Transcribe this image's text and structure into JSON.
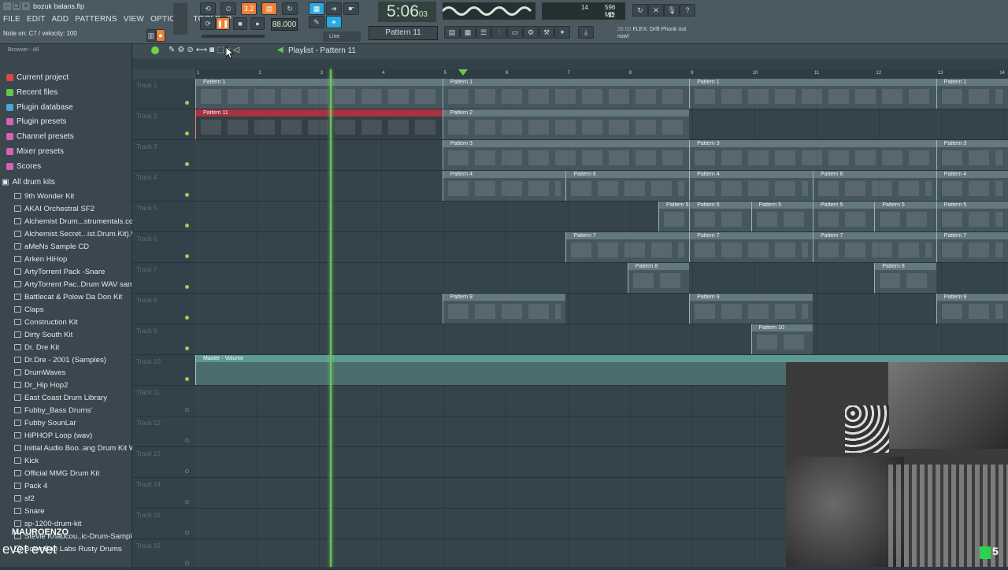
{
  "window": {
    "title": "bozuk balans.flp"
  },
  "menu": [
    "FILE",
    "EDIT",
    "ADD",
    "PATTERNS",
    "VIEW",
    "OPTIONS",
    "TOOLS",
    "?"
  ],
  "hint_bar": "Note on: C7 / velocity: 100",
  "transport": {
    "time": "5:06",
    "time_small": "03",
    "tempo": "88.000",
    "snap": "Line",
    "pattern": "Pattern 11"
  },
  "cpu": {
    "value1": "14",
    "value2": "596 MB",
    "value3": "12"
  },
  "news": {
    "date": "26.02",
    "text": "FLEX: Drift Phonk out now!"
  },
  "browser": {
    "header": "Browser - All",
    "categories": [
      {
        "label": "Current project",
        "color": "#e04646"
      },
      {
        "label": "Recent files",
        "color": "#6cc14a"
      },
      {
        "label": "Plugin database",
        "color": "#4ba3d8"
      },
      {
        "label": "Plugin presets",
        "color": "#d860b8"
      },
      {
        "label": "Channel presets",
        "color": "#d860b8"
      },
      {
        "label": "Mixer presets",
        "color": "#d860b8"
      },
      {
        "label": "Scores",
        "color": "#d860b8"
      }
    ],
    "folder_open": "All drum kits",
    "folders": [
      "9th Wonder Kit",
      "AKAI Orchestral SF2",
      "Alchemist Drum...strumentals.com)",
      "Alchemist.Secret...ist.Drum.Kit).WAV",
      "aMeNs Sample CD",
      "Arken HiHop",
      "ArtyTorrent Pack -Snare",
      "ArtyTorrent Pac..Drum WAV samples",
      "Battlecat & Polow Da Don Kit",
      "Claps",
      "Construction Kit",
      "Dirty South Kit",
      "Dr. Dre Kit",
      "Dr.Dre - 2001 (Samples)",
      "DrumWaves",
      "Dr_Hip Hop2",
      "East Coast Drum Library",
      "Fubby_Bass Drums'",
      "Fubby SounLar",
      "HiPHOP Loop (wav)",
      "Initial Audio Boo..ang Drum Kit WiN",
      "Kick",
      "Official MMG Drum Kit",
      "Pack 4",
      "sf2",
      "Snare",
      "sp-1200-drum-kit",
      "Stevie Knaucou..ic-Drum-Samples",
      "BoomBap Labs Rusty Drums"
    ]
  },
  "playlist": {
    "title": "Playlist - Pattern 11",
    "ruler": [
      "1",
      "2",
      "3",
      "4",
      "5",
      "6",
      "7",
      "8",
      "9",
      "10",
      "11",
      "12",
      "13",
      "14"
    ],
    "tracks": [
      "Track 1",
      "Track 2",
      "Track 3",
      "Track 4",
      "Track 5",
      "Track 6",
      "Track 7",
      "Track 8",
      "Track 9",
      "Track 10",
      "Track 11",
      "Track 12",
      "Track 13",
      "Track 14",
      "Track 15",
      "Track 16"
    ],
    "clips": [
      {
        "track": 0,
        "bar": 1,
        "len": 4,
        "label": "Pattern 1"
      },
      {
        "track": 0,
        "bar": 5,
        "len": 4,
        "label": "Pattern 1"
      },
      {
        "track": 0,
        "bar": 9,
        "len": 4,
        "label": "Pattern 1"
      },
      {
        "track": 0,
        "bar": 13,
        "len": 1.2,
        "label": "Pattern 1"
      },
      {
        "track": 1,
        "bar": 1,
        "len": 4,
        "label": "Pattern 11",
        "kind": "red"
      },
      {
        "track": 1,
        "bar": 5,
        "len": 4,
        "label": "Pattern 2"
      },
      {
        "track": 2,
        "bar": 5,
        "len": 4,
        "label": "Pattern 3"
      },
      {
        "track": 2,
        "bar": 9,
        "len": 4,
        "label": "Pattern 3"
      },
      {
        "track": 2,
        "bar": 13,
        "len": 1.2,
        "label": "Pattern 3"
      },
      {
        "track": 3,
        "bar": 5,
        "len": 2,
        "label": "Pattern 4"
      },
      {
        "track": 3,
        "bar": 7,
        "len": 2,
        "label": "Pattern 6"
      },
      {
        "track": 3,
        "bar": 9,
        "len": 2,
        "label": "Pattern 4"
      },
      {
        "track": 3,
        "bar": 11,
        "len": 2,
        "label": "Pattern 6"
      },
      {
        "track": 3,
        "bar": 13,
        "len": 1.2,
        "label": "Pattern 4"
      },
      {
        "track": 4,
        "bar": 8.5,
        "len": 0.5,
        "label": "Pattern 5"
      },
      {
        "track": 4,
        "bar": 9,
        "len": 1,
        "label": "Pattern 5"
      },
      {
        "track": 4,
        "bar": 10,
        "len": 1,
        "label": "Pattern 5"
      },
      {
        "track": 4,
        "bar": 11,
        "len": 1,
        "label": "Pattern 5"
      },
      {
        "track": 4,
        "bar": 12,
        "len": 1,
        "label": "Pattern 5"
      },
      {
        "track": 4,
        "bar": 13,
        "len": 1.2,
        "label": "Pattern 5"
      },
      {
        "track": 5,
        "bar": 7,
        "len": 2,
        "label": "Pattern 7"
      },
      {
        "track": 5,
        "bar": 9,
        "len": 2,
        "label": "Pattern 7"
      },
      {
        "track": 5,
        "bar": 11,
        "len": 2,
        "label": "Pattern 7"
      },
      {
        "track": 5,
        "bar": 13,
        "len": 1.2,
        "label": "Pattern 7"
      },
      {
        "track": 6,
        "bar": 8,
        "len": 1,
        "label": "Pattern 8"
      },
      {
        "track": 6,
        "bar": 12,
        "len": 1,
        "label": "Pattern 8"
      },
      {
        "track": 7,
        "bar": 5,
        "len": 2,
        "label": "Pattern 9"
      },
      {
        "track": 7,
        "bar": 9,
        "len": 2,
        "label": "Pattern 9"
      },
      {
        "track": 7,
        "bar": 13,
        "len": 1.2,
        "label": "Pattern 9"
      },
      {
        "track": 8,
        "bar": 10,
        "len": 1,
        "label": "Pattern 10"
      },
      {
        "track": 9,
        "bar": 1,
        "len": 13.2,
        "label": "Master - Volume",
        "kind": "auto"
      }
    ]
  },
  "overlay": {
    "name": "MAUROENZO",
    "caption": "evet evet",
    "badge": "5"
  }
}
